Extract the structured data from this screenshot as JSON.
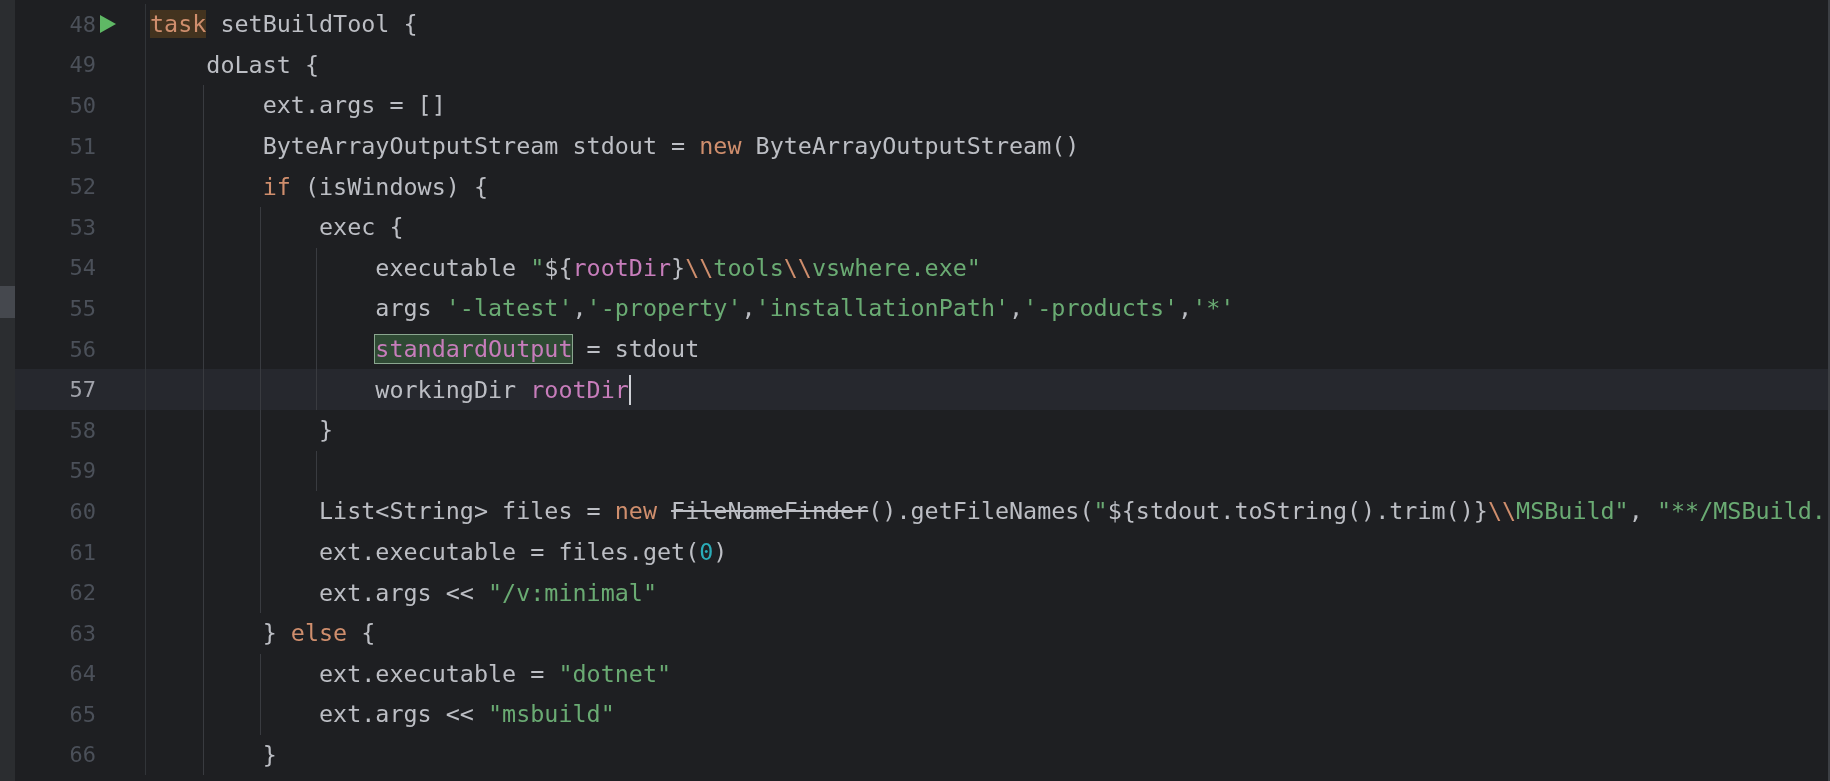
{
  "editor": {
    "lines": [
      {
        "number": "48",
        "current": false,
        "runnable": true,
        "tokens": [
          {
            "kind": "keyword_usage",
            "text": "task"
          },
          {
            "kind": "plain",
            "text": " setBuildTool {"
          }
        ]
      },
      {
        "number": "49",
        "current": false,
        "tokens": [
          {
            "kind": "plain",
            "text": "    doLast {"
          }
        ]
      },
      {
        "number": "50",
        "current": false,
        "tokens": [
          {
            "kind": "plain",
            "text": "        ext.args = []"
          }
        ]
      },
      {
        "number": "51",
        "current": false,
        "tokens": [
          {
            "kind": "plain",
            "text": "        ByteArrayOutputStream stdout = "
          },
          {
            "kind": "keyword",
            "text": "new"
          },
          {
            "kind": "plain",
            "text": " ByteArrayOutputStream()"
          }
        ]
      },
      {
        "number": "52",
        "current": false,
        "tokens": [
          {
            "kind": "keyword",
            "text": "        if"
          },
          {
            "kind": "plain",
            "text": " (isWindows) {"
          }
        ]
      },
      {
        "number": "53",
        "current": false,
        "tokens": [
          {
            "kind": "plain",
            "text": "            exec {"
          }
        ]
      },
      {
        "number": "54",
        "current": false,
        "tokens": [
          {
            "kind": "plain",
            "text": "                executable "
          },
          {
            "kind": "string",
            "text": "\""
          },
          {
            "kind": "plain",
            "text": "${"
          },
          {
            "kind": "property",
            "text": "rootDir"
          },
          {
            "kind": "plain",
            "text": "}"
          },
          {
            "kind": "escape",
            "text": "\\\\"
          },
          {
            "kind": "string",
            "text": "tools"
          },
          {
            "kind": "escape",
            "text": "\\\\"
          },
          {
            "kind": "string",
            "text": "vswhere.exe\""
          }
        ]
      },
      {
        "number": "55",
        "current": false,
        "tokens": [
          {
            "kind": "plain",
            "text": "                args "
          },
          {
            "kind": "string",
            "text": "'-latest'"
          },
          {
            "kind": "plain",
            "text": ","
          },
          {
            "kind": "string",
            "text": "'-property'"
          },
          {
            "kind": "plain",
            "text": ","
          },
          {
            "kind": "string",
            "text": "'installationPath'"
          },
          {
            "kind": "plain",
            "text": ","
          },
          {
            "kind": "string",
            "text": "'-products'"
          },
          {
            "kind": "plain",
            "text": ","
          },
          {
            "kind": "string",
            "text": "'*'"
          }
        ]
      },
      {
        "number": "56",
        "current": false,
        "tokens": [
          {
            "kind": "property_write_usage",
            "text": "                standardOutput"
          },
          {
            "kind": "plain",
            "text": " = stdout"
          }
        ]
      },
      {
        "number": "57",
        "current": true,
        "tokens": [
          {
            "kind": "plain",
            "text": "                workingDir "
          },
          {
            "kind": "property",
            "text": "rootDir"
          }
        ]
      },
      {
        "number": "58",
        "current": false,
        "tokens": [
          {
            "kind": "plain",
            "text": "            }"
          }
        ]
      },
      {
        "number": "59",
        "current": false
      },
      {
        "number": "60",
        "current": false,
        "tokens": [
          {
            "kind": "plain",
            "text": "            List<String> files = "
          },
          {
            "kind": "keyword",
            "text": "new "
          },
          {
            "kind": "deprecated",
            "text": "FileNameFinder"
          },
          {
            "kind": "plain",
            "text": "().getFileNames("
          },
          {
            "kind": "string",
            "text": "\""
          },
          {
            "kind": "plain",
            "text": "${stdout.toString().trim()}"
          },
          {
            "kind": "escape",
            "text": "\\\\"
          },
          {
            "kind": "string",
            "text": "MSBuild\""
          },
          {
            "kind": "plain",
            "text": ", "
          },
          {
            "kind": "string",
            "text": "\"**/MSBuild."
          }
        ]
      },
      {
        "number": "61",
        "current": false,
        "tokens": [
          {
            "kind": "plain",
            "text": "            ext.executable = files.get("
          },
          {
            "kind": "number",
            "text": "0"
          },
          {
            "kind": "plain",
            "text": ")"
          }
        ]
      },
      {
        "number": "62",
        "current": false,
        "tokens": [
          {
            "kind": "plain",
            "text": "            ext.args << "
          },
          {
            "kind": "string",
            "text": "\"/v:minimal\""
          }
        ]
      },
      {
        "number": "63",
        "current": false,
        "tokens": [
          {
            "kind": "plain",
            "text": "        } "
          },
          {
            "kind": "keyword",
            "text": "else"
          },
          {
            "kind": "plain",
            "text": " {"
          }
        ]
      },
      {
        "number": "64",
        "current": false,
        "tokens": [
          {
            "kind": "plain",
            "text": "            ext.executable = "
          },
          {
            "kind": "string",
            "text": "\"dotnet\""
          }
        ]
      },
      {
        "number": "65",
        "current": false,
        "tokens": [
          {
            "kind": "plain",
            "text": "            ext.args << "
          },
          {
            "kind": "string",
            "text": "\"msbuild\""
          }
        ]
      },
      {
        "number": "66",
        "current": false,
        "tokens": [
          {
            "kind": "plain",
            "text": "        }"
          }
        ]
      }
    ]
  }
}
